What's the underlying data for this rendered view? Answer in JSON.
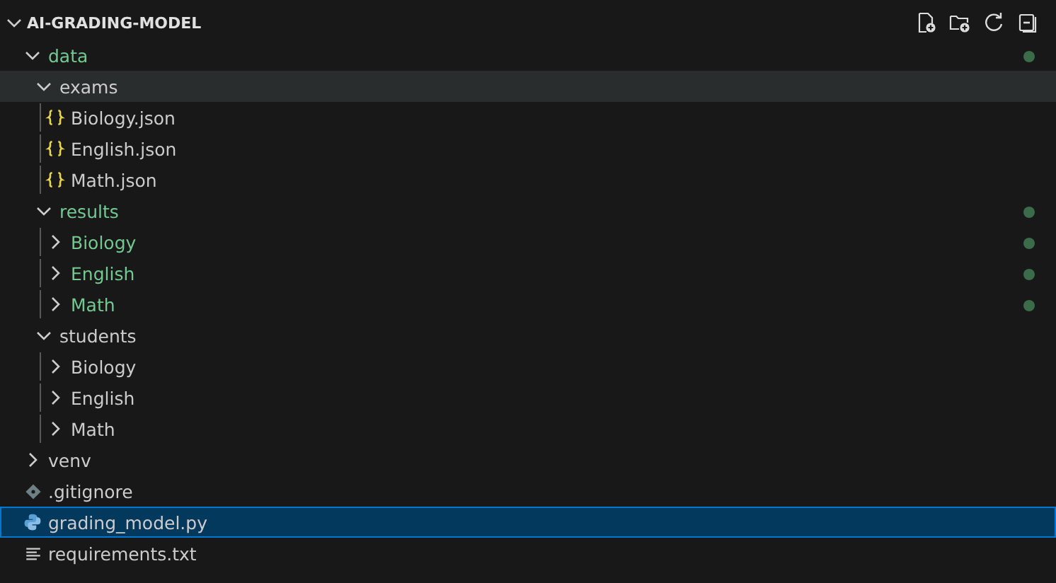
{
  "explorer": {
    "title": "AI-GRADING-MODEL",
    "expanded": true
  },
  "tree": [
    {
      "name": "data",
      "kind": "folder",
      "expanded": true,
      "untracked": true,
      "selected": false,
      "hovered": false,
      "children": [
        {
          "name": "exams",
          "kind": "folder",
          "expanded": true,
          "untracked": false,
          "selected": false,
          "hovered": true,
          "children": [
            {
              "name": "Biology.json",
              "kind": "json",
              "untracked": false,
              "selected": false,
              "hovered": false
            },
            {
              "name": "English.json",
              "kind": "json",
              "untracked": false,
              "selected": false,
              "hovered": false
            },
            {
              "name": "Math.json",
              "kind": "json",
              "untracked": false,
              "selected": false,
              "hovered": false
            }
          ]
        },
        {
          "name": "results",
          "kind": "folder",
          "expanded": true,
          "untracked": true,
          "selected": false,
          "hovered": false,
          "children": [
            {
              "name": "Biology",
              "kind": "folder",
              "expanded": false,
              "untracked": true,
              "selected": false,
              "hovered": false
            },
            {
              "name": "English",
              "kind": "folder",
              "expanded": false,
              "untracked": true,
              "selected": false,
              "hovered": false
            },
            {
              "name": "Math",
              "kind": "folder",
              "expanded": false,
              "untracked": true,
              "selected": false,
              "hovered": false
            }
          ]
        },
        {
          "name": "students",
          "kind": "folder",
          "expanded": true,
          "untracked": false,
          "selected": false,
          "hovered": false,
          "children": [
            {
              "name": "Biology",
              "kind": "folder",
              "expanded": false,
              "untracked": false,
              "selected": false,
              "hovered": false
            },
            {
              "name": "English",
              "kind": "folder",
              "expanded": false,
              "untracked": false,
              "selected": false,
              "hovered": false
            },
            {
              "name": "Math",
              "kind": "folder",
              "expanded": false,
              "untracked": false,
              "selected": false,
              "hovered": false
            }
          ]
        }
      ]
    },
    {
      "name": "venv",
      "kind": "folder",
      "expanded": false,
      "untracked": false,
      "selected": false,
      "hovered": false
    },
    {
      "name": ".gitignore",
      "kind": "git",
      "untracked": false,
      "selected": false,
      "hovered": false
    },
    {
      "name": "grading_model.py",
      "kind": "python",
      "untracked": false,
      "selected": true,
      "hovered": false
    },
    {
      "name": "requirements.txt",
      "kind": "text",
      "untracked": false,
      "selected": false,
      "hovered": false
    }
  ]
}
